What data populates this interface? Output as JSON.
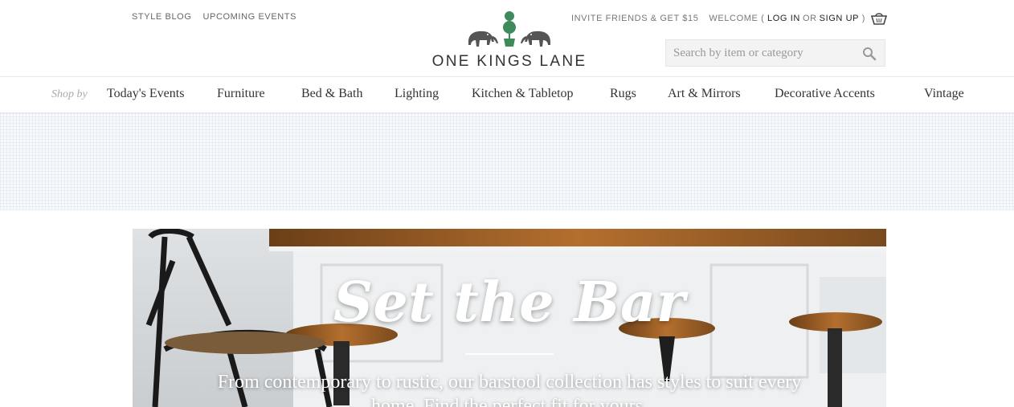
{
  "utility_left": [
    "STYLE BLOG",
    "UPCOMING EVENTS"
  ],
  "utility_right": {
    "invite": "INVITE FRIENDS & GET $15",
    "welcome": "WELCOME (",
    "login": "LOG IN",
    "or": "OR",
    "signup": "SIGN UP",
    "close_paren": ")"
  },
  "logo": {
    "text": "ONE KINGS LANE"
  },
  "search": {
    "placeholder": "Search by item or category"
  },
  "nav": {
    "shop_by": "Shop by",
    "items": [
      "Today's Events",
      "Furniture",
      "Bed & Bath",
      "Lighting",
      "Kitchen & Tabletop",
      "Rugs",
      "Art & Mirrors",
      "Decorative Accents",
      "Vintage"
    ]
  },
  "hero": {
    "title": "Set the Bar",
    "subtitle": "From contemporary to rustic, our barstool collection has styles to suit every home. Find the perfect fit for yours."
  },
  "colors": {
    "logo_green": "#3d8b5a",
    "text_dark": "#333333"
  }
}
